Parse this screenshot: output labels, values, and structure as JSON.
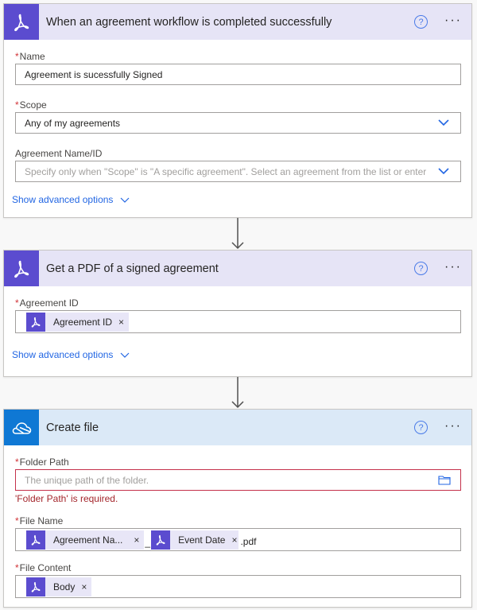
{
  "cards": [
    {
      "title": "When an agreement workflow is completed successfully",
      "icon": "adobe-sign-icon",
      "fields": {
        "name": {
          "label": "Name",
          "required": true,
          "value": "Agreement is sucessfully Signed"
        },
        "scope": {
          "label": "Scope",
          "required": true,
          "value": "Any of my agreements"
        },
        "agreement_name_id": {
          "label": "Agreement Name/ID",
          "required": false,
          "placeholder": "Specify only when \"Scope\" is \"A specific agreement\". Select an agreement from the list or enter th"
        }
      },
      "advanced_link": "Show advanced options"
    },
    {
      "title": "Get a PDF of a signed agreement",
      "icon": "adobe-sign-icon",
      "fields": {
        "agreement_id": {
          "label": "Agreement ID",
          "required": true,
          "tokens": [
            "Agreement ID"
          ]
        }
      },
      "advanced_link": "Show advanced options"
    },
    {
      "title": "Create file",
      "icon": "onedrive-icon",
      "fields": {
        "folder_path": {
          "label": "Folder Path",
          "required": true,
          "placeholder": "The unique path of the folder.",
          "error": "'Folder Path' is required."
        },
        "file_name": {
          "label": "File Name",
          "required": true,
          "tokens": [
            "Agreement Na...",
            "Event Date"
          ],
          "separator": "_",
          "suffix": ".pdf"
        },
        "file_content": {
          "label": "File Content",
          "required": true,
          "tokens": [
            "Body"
          ]
        }
      }
    }
  ],
  "common": {
    "required_mark": "*",
    "help_glyph": "?",
    "more_glyph": "···",
    "remove_glyph": "×"
  },
  "colors": {
    "adobe_brand": "#5b4ccf",
    "onedrive_brand": "#0f78d4",
    "link": "#2266e3",
    "error": "#a4262c"
  }
}
